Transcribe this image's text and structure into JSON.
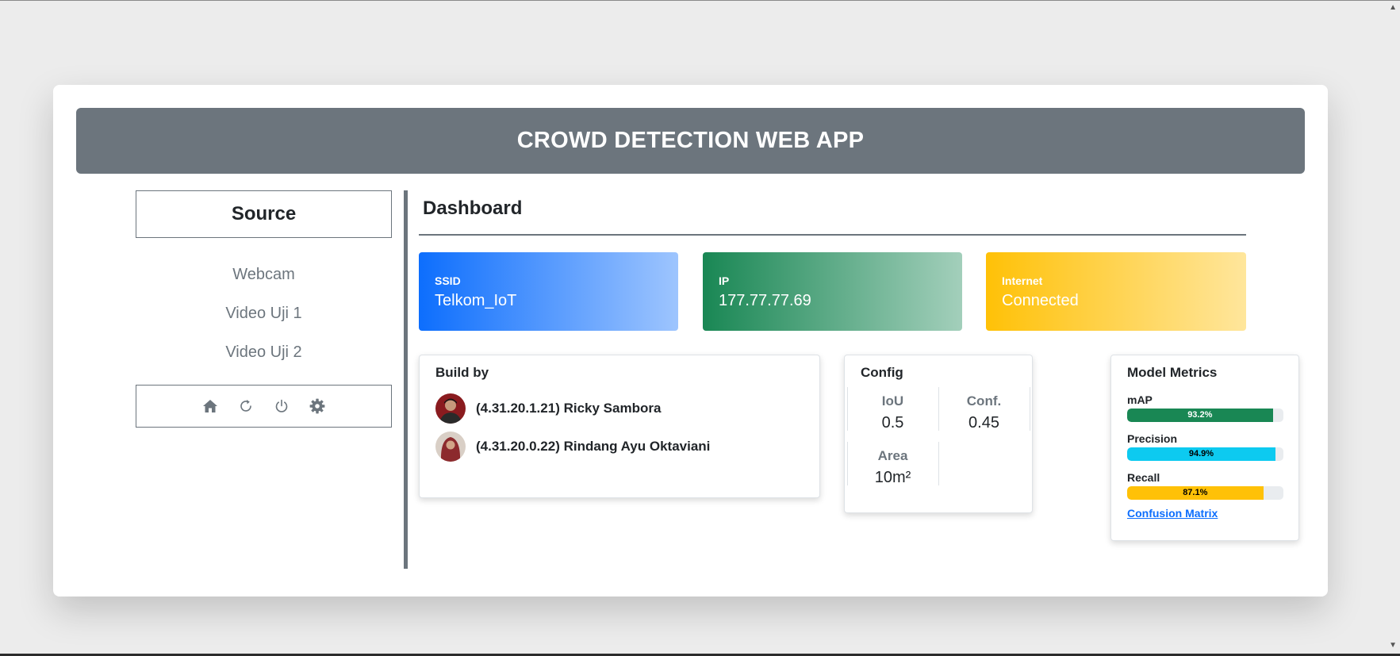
{
  "header": {
    "title": "CROWD DETECTION WEB APP"
  },
  "sidebar": {
    "source_title": "Source",
    "items": [
      {
        "label": "Webcam"
      },
      {
        "label": "Video Uji 1"
      },
      {
        "label": "Video Uji 2"
      }
    ],
    "actions": [
      "home-icon",
      "refresh-icon",
      "power-icon",
      "gear-icon"
    ]
  },
  "dashboard": {
    "title": "Dashboard",
    "stats": {
      "ssid": {
        "label": "SSID",
        "value": "Telkom_IoT"
      },
      "ip": {
        "label": "IP",
        "value": "177.77.77.69"
      },
      "internet": {
        "label": "Internet",
        "value": "Connected"
      }
    },
    "build": {
      "title": "Build by",
      "members": [
        {
          "name": "(4.31.20.1.21) Ricky Sambora"
        },
        {
          "name": "(4.31.20.0.22) Rindang Ayu Oktaviani"
        }
      ]
    },
    "config": {
      "title": "Config",
      "iou": {
        "label": "IoU",
        "value": "0.5"
      },
      "conf": {
        "label": "Conf.",
        "value": "0.45"
      },
      "area": {
        "label": "Area",
        "value": "10m²"
      }
    },
    "metrics": {
      "title": "Model Metrics",
      "map": {
        "label": "mAP",
        "text": "93.2%",
        "percent": 93.2
      },
      "precision": {
        "label": "Precision",
        "text": "94.9%",
        "percent": 94.9
      },
      "recall": {
        "label": "Recall",
        "text": "87.1%",
        "percent": 87.1
      },
      "link": "Confusion Matrix"
    }
  },
  "colors": {
    "header_bg": "#6c757d",
    "primary": "#0d6efd",
    "success": "#198754",
    "warning": "#ffc107",
    "info": "#0dcaf0"
  }
}
